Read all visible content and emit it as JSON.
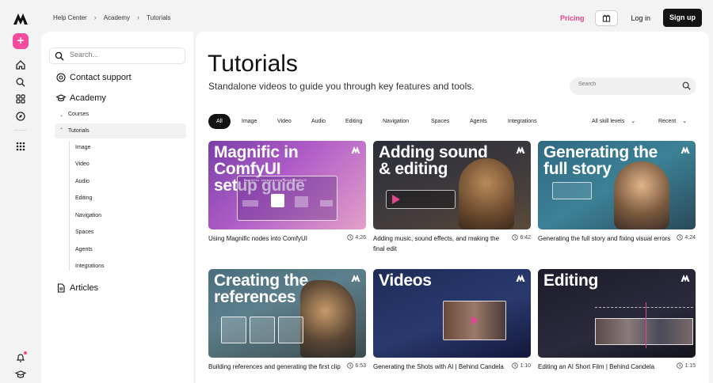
{
  "breadcrumb": [
    "Help Center",
    "Academy",
    "Tutorials"
  ],
  "header": {
    "pricing": "Pricing",
    "login": "Log in",
    "signup": "Sign up"
  },
  "sidebar": {
    "search_placeholder": "Search...",
    "contact": "Contact support",
    "academy": "Academy",
    "courses": "Courses",
    "tutorials": "Tutorials",
    "children": [
      "Image",
      "Video",
      "Audio",
      "Editing",
      "Navigation",
      "Spaces",
      "Agents",
      "Integrations"
    ],
    "articles": "Articles"
  },
  "main": {
    "title": "Tutorials",
    "subtitle": "Standalone videos to guide you through key features and tools.",
    "search_placeholder": "Search",
    "tabs": [
      "All",
      "Image",
      "Video",
      "Audio",
      "Editing",
      "Navigation",
      "Spaces",
      "Agents",
      "Integrations"
    ],
    "skill_filter": "All skill levels",
    "sort": "Recent",
    "cards": [
      {
        "thumb_title": "Magnific in ComfyUI setup guide",
        "thumb_line1": "Magnific in ComfyUI",
        "thumb_line2": "setup guide",
        "caption": "Using Magnific nodes into ComfyUI",
        "duration": "4:26"
      },
      {
        "thumb_title": "Adding sound & editing",
        "thumb_line1": "Adding sound",
        "thumb_line2": "& editing",
        "caption": "Adding music, sound effects, and making the final edit",
        "duration": "6:42"
      },
      {
        "thumb_title": "Generating the full story",
        "thumb_line1": "Generating the",
        "thumb_line2": "full story",
        "caption": "Generating the full story and fixing visual errors",
        "duration": "4:24"
      },
      {
        "thumb_title": "Creating the references",
        "thumb_line1": "Creating the",
        "thumb_line2": "references",
        "caption": "Building references and generating the first clip",
        "duration": "6:53"
      },
      {
        "thumb_title": "Videos",
        "thumb_line1": "Videos",
        "thumb_line2": "",
        "caption": "Generating the Shots with AI | Behind Candela",
        "duration": "1:10"
      },
      {
        "thumb_title": "Editing",
        "thumb_line1": "Editing",
        "thumb_line2": "",
        "caption": "Editing an AI Short Film | Behind Candela",
        "duration": "1:15"
      }
    ],
    "thumb_small_text": "Magnific integrating with ComfyUI"
  },
  "colors": {
    "accent_pink": "#f44aa0",
    "pricing": "#e0458e",
    "dark": "#141414"
  }
}
